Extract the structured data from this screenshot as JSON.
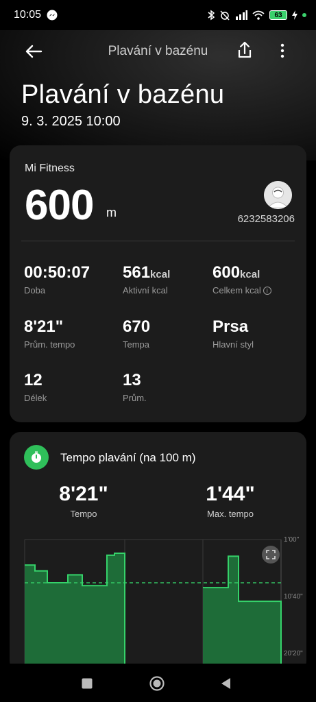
{
  "status": {
    "time": "10:05",
    "battery": "63"
  },
  "header": {
    "title": "Plavání v bazénu"
  },
  "page": {
    "title": "Plavání v bazénu",
    "date": "9. 3. 2025 10:00"
  },
  "summary": {
    "source": "Mi Fitness",
    "distance": "600",
    "distance_unit": "m",
    "user_id": "6232583206",
    "stats": [
      {
        "value": "00:50:07",
        "unit": "",
        "label": "Doba"
      },
      {
        "value": "561",
        "unit": "kcal",
        "label": "Aktivní kcal"
      },
      {
        "value": "600",
        "unit": "kcal",
        "label": "Celkem kcal"
      },
      {
        "value": "8'21\"",
        "unit": "",
        "label": "Prům. tempo"
      },
      {
        "value": "670",
        "unit": "",
        "label": "Tempa"
      },
      {
        "value": "Prsa",
        "unit": "",
        "label": "Hlavní styl"
      },
      {
        "value": "12",
        "unit": "",
        "label": "Délek"
      },
      {
        "value": "13",
        "unit": "",
        "label": "Prům."
      }
    ]
  },
  "pace": {
    "title": "Tempo plavání (na 100 m)",
    "avg_value": "8'21\"",
    "avg_label": "Tempo",
    "max_value": "1'44\"",
    "max_label": "Max. tempo"
  },
  "chart_data": {
    "type": "area",
    "y_tick_labels": [
      "1'00\"",
      "10'40\"",
      "20'20\""
    ],
    "yaxis_reversed": true,
    "ylim_seconds": [
      60,
      1220
    ],
    "average_seconds": 501,
    "segments": [
      {
        "y_seconds": [
          320,
          320,
          380,
          380,
          500,
          500,
          420,
          420,
          530,
          530,
          220,
          220,
          200,
          200
        ]
      },
      {
        "y_seconds": [
          550,
          550,
          230,
          230,
          690,
          690
        ]
      }
    ],
    "grid": true,
    "colors": {
      "fill": "#1f7a3d",
      "line": "#35d36a",
      "average": "#35d36a"
    }
  }
}
